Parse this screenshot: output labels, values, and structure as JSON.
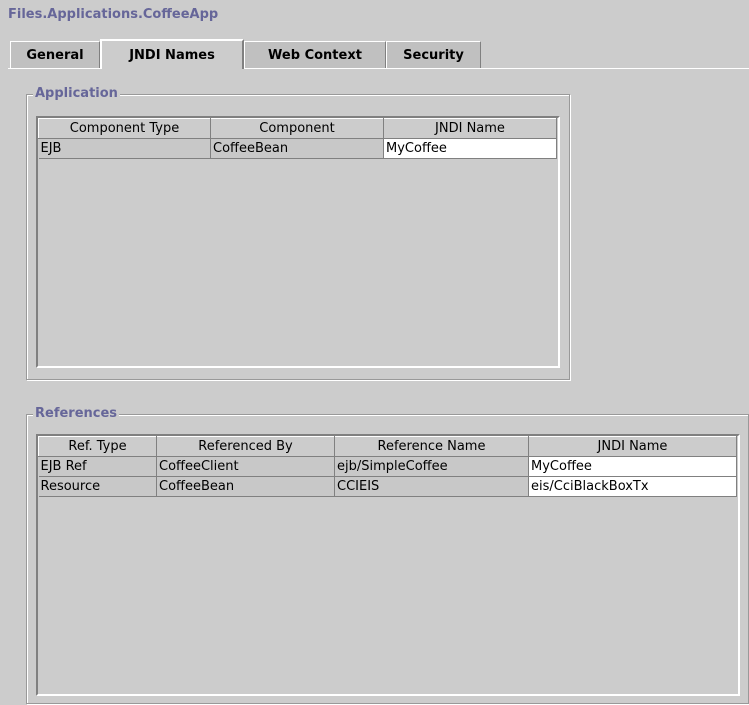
{
  "window": {
    "title": "Files.Applications.CoffeeApp"
  },
  "tabs": [
    {
      "label": "General",
      "active": false
    },
    {
      "label": "JNDI Names",
      "active": true
    },
    {
      "label": "Web Context",
      "active": false
    },
    {
      "label": "Security",
      "active": false
    }
  ],
  "application": {
    "title": "Application",
    "columns": [
      "Component Type",
      "Component",
      "JNDI Name"
    ],
    "rows": [
      [
        "EJB",
        "CoffeeBean",
        "MyCoffee"
      ]
    ]
  },
  "references": {
    "title": "References",
    "columns": [
      "Ref. Type",
      "Referenced By",
      "Reference Name",
      "JNDI Name"
    ],
    "rows": [
      [
        "EJB Ref",
        "CoffeeClient",
        "ejb/SimpleCoffee",
        "MyCoffee"
      ],
      [
        "Resource",
        "CoffeeBean",
        "CCIEIS",
        "eis/CciBlackBoxTx"
      ]
    ]
  },
  "colors": {
    "background": "#cccccc",
    "title_text": "#666699",
    "editable_cell": "#ffffff"
  }
}
